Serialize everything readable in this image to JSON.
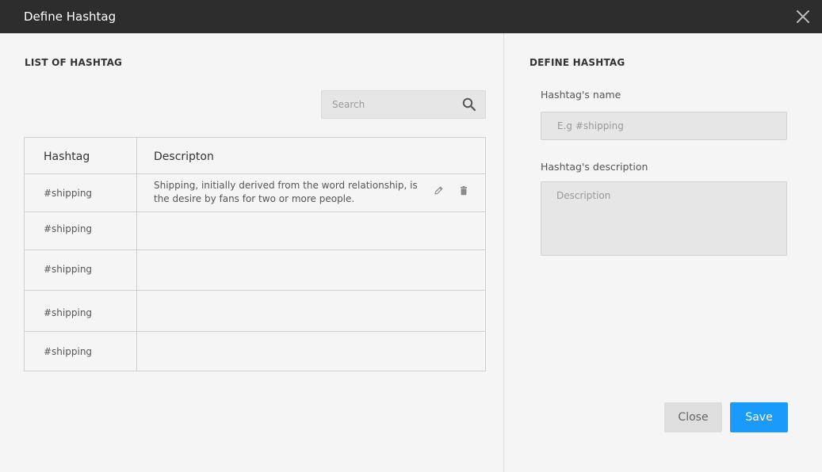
{
  "dialog": {
    "title": "Define Hashtag"
  },
  "list": {
    "section_title": "LIST OF HASHTAG",
    "search": {
      "placeholder": "Search",
      "icon": "search-icon"
    },
    "columns": [
      "Hashtag",
      "Descripton"
    ],
    "rows": [
      {
        "hashtag": "#shipping",
        "description": "Shipping, initially derived from the word relationship, is the desire by fans for two or more people."
      },
      {
        "hashtag": "#shipping",
        "description": ""
      },
      {
        "hashtag": "#shipping",
        "description": ""
      },
      {
        "hashtag": "#shipping",
        "description": ""
      },
      {
        "hashtag": "#shipping",
        "description": ""
      }
    ],
    "row_actions": [
      "edit-icon",
      "trash-icon"
    ]
  },
  "form": {
    "section_title": "DEFINE HASHTAG",
    "name_label": "Hashtag's name",
    "name_placeholder": "E.g #shipping",
    "description_label": "Hashtag's description",
    "description_placeholder": "Description",
    "close_label": "Close",
    "save_label": "Save"
  },
  "colors": {
    "titlebar": "#2d2d2d",
    "panel": "#f5f5f5",
    "primary": "#1a9bfc",
    "secondary_button": "#dedede"
  }
}
